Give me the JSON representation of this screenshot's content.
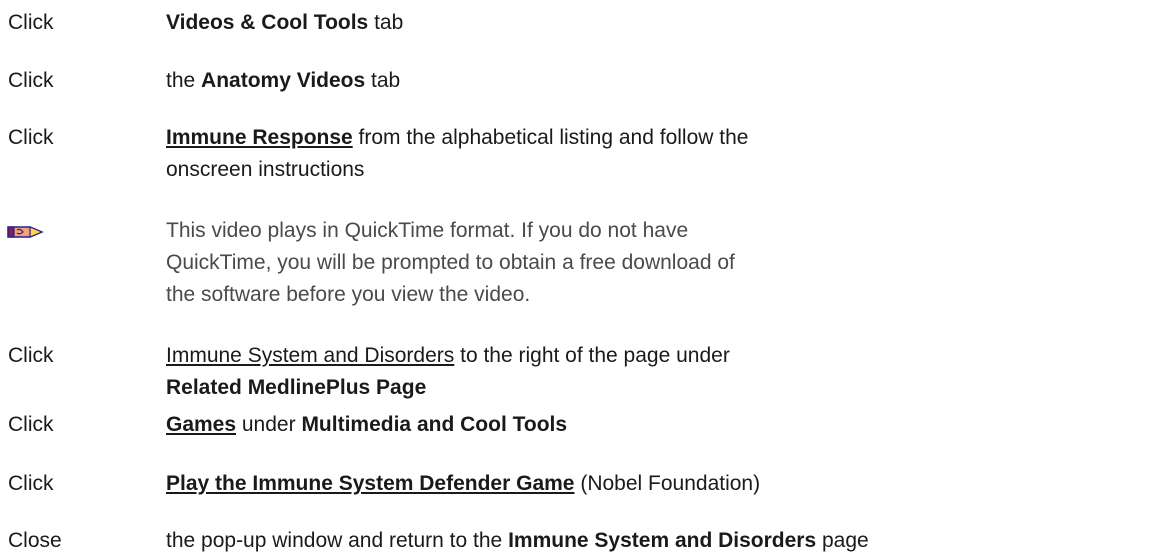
{
  "steps": [
    {
      "verb": "Click",
      "parts": [
        {
          "t": "Videos & Cool Tools",
          "s": "b"
        },
        {
          "t": " tab",
          "s": ""
        }
      ]
    },
    {
      "verb": "Click",
      "parts": [
        {
          "t": "the ",
          "s": ""
        },
        {
          "t": "Anatomy Videos",
          "s": "b"
        },
        {
          "t": " tab",
          "s": ""
        }
      ]
    },
    {
      "verb": "Click",
      "parts": [
        {
          "t": "Immune Response",
          "s": "bu"
        },
        {
          "t": " from the alphabetical listing and follow the onscreen instructions",
          "s": ""
        }
      ]
    },
    {
      "note": "This video plays in QuickTime format. If you do not have QuickTime, you will be prompted to obtain a free download of the software before you view the video.",
      "icon": "pencil-note-icon"
    },
    {
      "verb": "Click",
      "parts": [
        {
          "t": "Immune System and Disorders",
          "s": "u"
        },
        {
          "t": " to the right of the page under ",
          "s": ""
        },
        {
          "t": "Related MedlinePlus Page",
          "s": "b"
        }
      ]
    },
    {
      "verb": "Click",
      "parts": [
        {
          "t": "Games",
          "s": "bu"
        },
        {
          "t": " under ",
          "s": ""
        },
        {
          "t": "Multimedia and Cool Tools",
          "s": "b"
        }
      ]
    },
    {
      "verb": "Click",
      "parts": [
        {
          "t": "Play the Immune System Defender Game",
          "s": "bu"
        },
        {
          "t": " (Nobel Foundation)",
          "s": ""
        }
      ]
    },
    {
      "verb": "Close",
      "parts": [
        {
          "t": "the pop-up window and return to the ",
          "s": ""
        },
        {
          "t": "Immune System and Disorders",
          "s": "b"
        },
        {
          "t": " page",
          "s": ""
        }
      ]
    }
  ]
}
